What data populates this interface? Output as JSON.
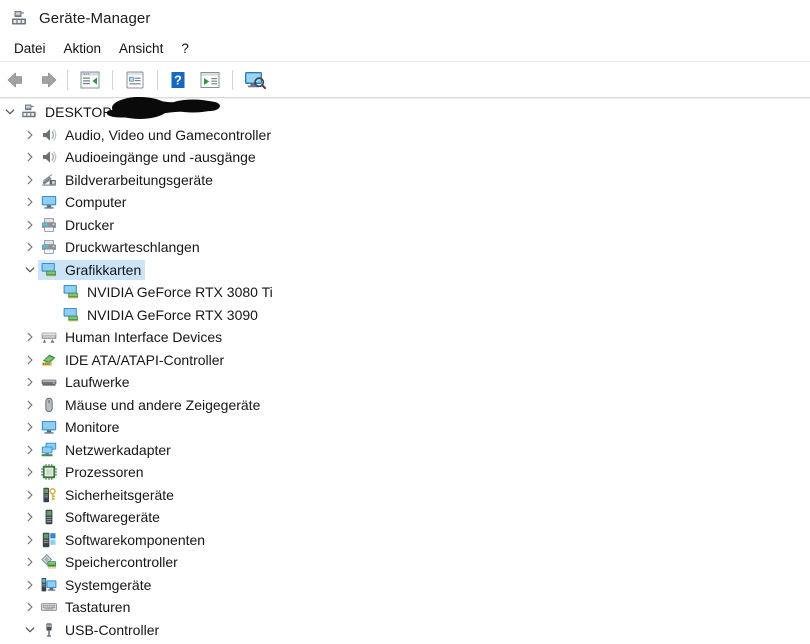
{
  "window": {
    "title": "Geräte-Manager",
    "title_icon": "device-manager-icon"
  },
  "menubar": {
    "items": [
      {
        "label": "Datei",
        "name": "menu-datei"
      },
      {
        "label": "Aktion",
        "name": "menu-aktion"
      },
      {
        "label": "Ansicht",
        "name": "menu-ansicht"
      },
      {
        "label": "?",
        "name": "menu-help"
      }
    ]
  },
  "toolbar": {
    "buttons": [
      {
        "name": "back-button",
        "icon": "arrow-left-icon",
        "tip": "Zurück"
      },
      {
        "name": "forward-button",
        "icon": "arrow-right-icon",
        "tip": "Vorwärts"
      },
      {
        "name": "show-hide-console-tree-button",
        "icon": "console-tree-icon",
        "tip": "Konsolenstruktur ein-/ausblenden"
      },
      {
        "name": "properties-button",
        "icon": "properties-icon",
        "tip": "Eigenschaften"
      },
      {
        "name": "help-button",
        "icon": "help-question-icon",
        "tip": "Hilfe"
      },
      {
        "name": "scan-hardware-changes-button",
        "icon": "scan-changes-icon",
        "tip": "Nach geänderter Hardware suchen"
      },
      {
        "name": "show-hidden-devices-button",
        "icon": "monitor-search-icon",
        "tip": "Ausgeblendete Geräte anzeigen"
      }
    ]
  },
  "tree": {
    "nodes": [
      {
        "label": "DESKTOP-",
        "level": 0,
        "state": "expanded",
        "icon": "computer-root-icon",
        "redacted": true,
        "selected": false
      },
      {
        "label": "Audio, Video und Gamecontroller",
        "level": 1,
        "state": "collapsed",
        "icon": "speaker-icon",
        "selected": false
      },
      {
        "label": "Audioeingänge und -ausgänge",
        "level": 1,
        "state": "collapsed",
        "icon": "speaker-icon",
        "selected": false
      },
      {
        "label": "Bildverarbeitungsgeräte",
        "level": 1,
        "state": "collapsed",
        "icon": "camera-icon",
        "selected": false
      },
      {
        "label": "Computer",
        "level": 1,
        "state": "collapsed",
        "icon": "monitor-icon",
        "selected": false
      },
      {
        "label": "Drucker",
        "level": 1,
        "state": "collapsed",
        "icon": "printer-icon",
        "selected": false
      },
      {
        "label": "Druckwarteschlangen",
        "level": 1,
        "state": "collapsed",
        "icon": "printer-icon",
        "selected": false
      },
      {
        "label": "Grafikkarten",
        "level": 1,
        "state": "expanded",
        "icon": "display-adapter-icon",
        "selected": true
      },
      {
        "label": "NVIDIA GeForce RTX 3080 Ti",
        "level": 2,
        "state": "leaf",
        "icon": "display-adapter-icon",
        "selected": false
      },
      {
        "label": "NVIDIA GeForce RTX 3090",
        "level": 2,
        "state": "leaf",
        "icon": "display-adapter-icon",
        "selected": false
      },
      {
        "label": "Human Interface Devices",
        "level": 1,
        "state": "collapsed",
        "icon": "hid-icon",
        "selected": false
      },
      {
        "label": "IDE ATA/ATAPI-Controller",
        "level": 1,
        "state": "collapsed",
        "icon": "ide-controller-icon",
        "selected": false
      },
      {
        "label": "Laufwerke",
        "level": 1,
        "state": "collapsed",
        "icon": "disk-drive-icon",
        "selected": false
      },
      {
        "label": "Mäuse und andere Zeigegeräte",
        "level": 1,
        "state": "collapsed",
        "icon": "mouse-icon",
        "selected": false
      },
      {
        "label": "Monitore",
        "level": 1,
        "state": "collapsed",
        "icon": "monitor-icon",
        "selected": false
      },
      {
        "label": "Netzwerkadapter",
        "level": 1,
        "state": "collapsed",
        "icon": "network-adapter-icon",
        "selected": false
      },
      {
        "label": "Prozessoren",
        "level": 1,
        "state": "collapsed",
        "icon": "cpu-icon",
        "selected": false
      },
      {
        "label": "Sicherheitsgeräte",
        "level": 1,
        "state": "collapsed",
        "icon": "security-device-icon",
        "selected": false
      },
      {
        "label": "Softwaregeräte",
        "level": 1,
        "state": "collapsed",
        "icon": "software-device-icon",
        "selected": false
      },
      {
        "label": "Softwarekomponenten",
        "level": 1,
        "state": "collapsed",
        "icon": "software-component-icon",
        "selected": false
      },
      {
        "label": "Speichercontroller",
        "level": 1,
        "state": "collapsed",
        "icon": "storage-controller-icon",
        "selected": false
      },
      {
        "label": "Systemgeräte",
        "level": 1,
        "state": "collapsed",
        "icon": "system-device-icon",
        "selected": false
      },
      {
        "label": "Tastaturen",
        "level": 1,
        "state": "collapsed",
        "icon": "keyboard-icon",
        "selected": false
      },
      {
        "label": "USB-Controller",
        "level": 1,
        "state": "expanded",
        "icon": "usb-icon",
        "selected": false
      }
    ]
  },
  "colors": {
    "selection": "#cce4f7",
    "text": "#161616",
    "chevron": "#666666",
    "redaction": "#000000",
    "toolbar_separator": "#d4d4d4",
    "accent_blue": "#1668c1"
  }
}
